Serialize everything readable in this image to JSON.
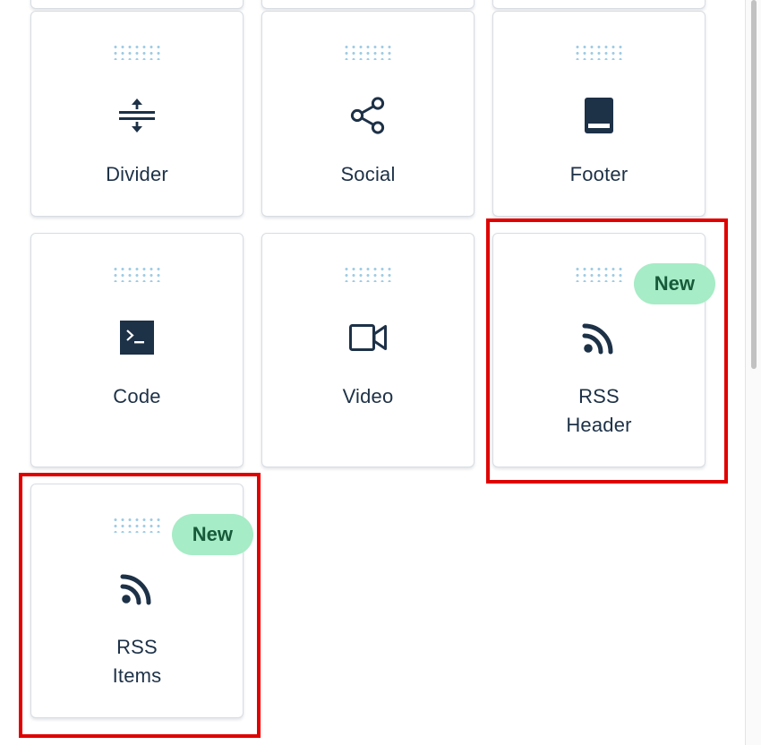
{
  "blocks": [
    {
      "label": "Divider",
      "icon": "divider-icon",
      "badge": ""
    },
    {
      "label": "Social",
      "icon": "share-icon",
      "badge": ""
    },
    {
      "label": "Footer",
      "icon": "footer-icon",
      "badge": ""
    },
    {
      "label": "Code",
      "icon": "terminal-icon",
      "badge": ""
    },
    {
      "label": "Video",
      "icon": "video-camera-icon",
      "badge": ""
    },
    {
      "label_lines": [
        "RSS",
        "Header"
      ],
      "icon": "rss-icon",
      "badge": "New"
    },
    {
      "label_lines": [
        "RSS",
        "Items"
      ],
      "icon": "rss-icon",
      "badge": "New"
    }
  ],
  "colors": {
    "icon": "#1d3147",
    "drag_handle": "#9fcbe4",
    "badge_bg": "#a6ecc6",
    "badge_text": "#175a3a",
    "highlight": "#e00000"
  }
}
